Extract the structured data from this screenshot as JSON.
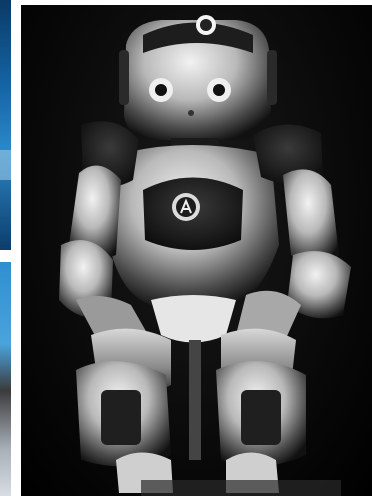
{
  "gallery": {
    "thumbnails": [
      {
        "subject": "blue-scene"
      },
      {
        "subject": "blue-and-grey-scene"
      }
    ],
    "main_photo": {
      "subject": "humanoid-robot",
      "palette": "black-and-white"
    }
  }
}
